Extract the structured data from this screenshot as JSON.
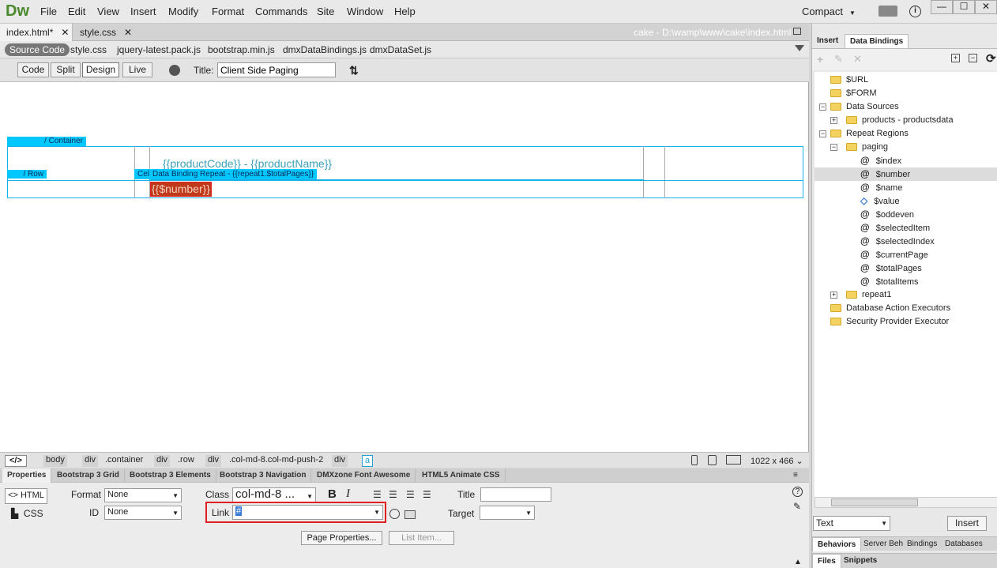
{
  "app": {
    "logo": "Dw"
  },
  "menu": [
    "File",
    "Edit",
    "View",
    "Insert",
    "Modify",
    "Format",
    "Commands",
    "Site",
    "Window",
    "Help"
  ],
  "workspace": {
    "label": "Compact"
  },
  "window_controls": {
    "minimize": "—",
    "maximize": "☐",
    "close": "✕"
  },
  "doc_tabs": [
    {
      "label": "index.html*",
      "close": "✕"
    },
    {
      "label": "style.css",
      "close": "✕"
    }
  ],
  "doc_path": "cake - D:\\wamp\\www\\cake\\index.html",
  "related_files": {
    "source": "Source Code",
    "files": [
      "style.css",
      "jquery-latest.pack.js",
      "bootstrap.min.js",
      "dmxDataBindings.js",
      "dmxDataSet.js"
    ]
  },
  "view_buttons": [
    "Code",
    "Split",
    "Design",
    "Live"
  ],
  "title_field": {
    "label": "Title:",
    "value": "Client Side Paging"
  },
  "design": {
    "container_label": "/ Container",
    "row_label": "/ Row",
    "cell_label": "Cell",
    "repeat_label": "Data Binding Repeat - {{repeat1.$totalPages}}",
    "product_expr": "{{productCode}} - {{productName}}",
    "number_expr": "{{$number}}"
  },
  "tag_selector": {
    "code_icon": "</>",
    "tags": [
      "body",
      "div",
      ".container",
      "div",
      ".row",
      "div",
      ".col-md-8.col-md-push-2",
      "div",
      "a"
    ],
    "size": "1022 x 466 ⌄"
  },
  "props_tabs": [
    "Properties",
    "Bootstrap 3 Grid",
    "Bootstrap 3 Elements",
    "Bootstrap 3 Navigation",
    "DMXzone Font Awesome",
    "HTML5 Animate CSS"
  ],
  "props": {
    "html_btn": "HTML",
    "css_btn": "CSS",
    "format_label": "Format",
    "format_value": "None",
    "id_label": "ID",
    "id_value": "None",
    "class_label": "Class",
    "class_value": "col-md-8 ...",
    "bold": "B",
    "italic": "I",
    "link_label": "Link",
    "link_value": "#",
    "title_label": "Title",
    "title_value": "",
    "target_label": "Target",
    "target_value": "",
    "page_props_btn": "Page Properties...",
    "list_item_btn": "List Item..."
  },
  "right_panel": {
    "tabs": [
      "Insert",
      "Data Bindings"
    ],
    "tree": [
      {
        "label": "$URL",
        "type": "folder",
        "indent": 0
      },
      {
        "label": "$FORM",
        "type": "folder",
        "indent": 0
      },
      {
        "label": "Data Sources",
        "type": "folder",
        "indent": 0,
        "expander": "−"
      },
      {
        "label": "products - productsdata",
        "type": "folder",
        "indent": 1,
        "expander": "+"
      },
      {
        "label": "Repeat Regions",
        "type": "folder",
        "indent": 0,
        "expander": "−"
      },
      {
        "label": "paging",
        "type": "folder",
        "indent": 1,
        "expander": "−"
      },
      {
        "label": "$index",
        "type": "at",
        "indent": 2
      },
      {
        "label": "$number",
        "type": "at",
        "indent": 2,
        "selected": true
      },
      {
        "label": "$name",
        "type": "at",
        "indent": 2
      },
      {
        "label": "$value",
        "type": "diamond",
        "indent": 2
      },
      {
        "label": "$oddeven",
        "type": "at",
        "indent": 2
      },
      {
        "label": "$selectedItem",
        "type": "at",
        "indent": 2
      },
      {
        "label": "$selectedIndex",
        "type": "at",
        "indent": 2
      },
      {
        "label": "$currentPage",
        "type": "at",
        "indent": 2
      },
      {
        "label": "$totalPages",
        "type": "at",
        "indent": 2
      },
      {
        "label": "$totalItems",
        "type": "at",
        "indent": 2
      },
      {
        "label": "repeat1",
        "type": "folder",
        "indent": 1,
        "expander": "+"
      },
      {
        "label": "Database Action Executors",
        "type": "folder",
        "indent": 0
      },
      {
        "label": "Security Provider Executor",
        "type": "folder",
        "indent": 0
      }
    ],
    "insert_as": "Text",
    "insert_btn": "Insert",
    "bottom_tabs_1": [
      "Behaviors",
      "Server Beh",
      "Bindings",
      "Databases"
    ],
    "bottom_tabs_2": [
      "Files",
      "Snippets"
    ]
  },
  "colors": {
    "accent_cyan": "#00c8ff",
    "highlight_red": "#e02020",
    "logo_green": "#4a8a2e"
  }
}
